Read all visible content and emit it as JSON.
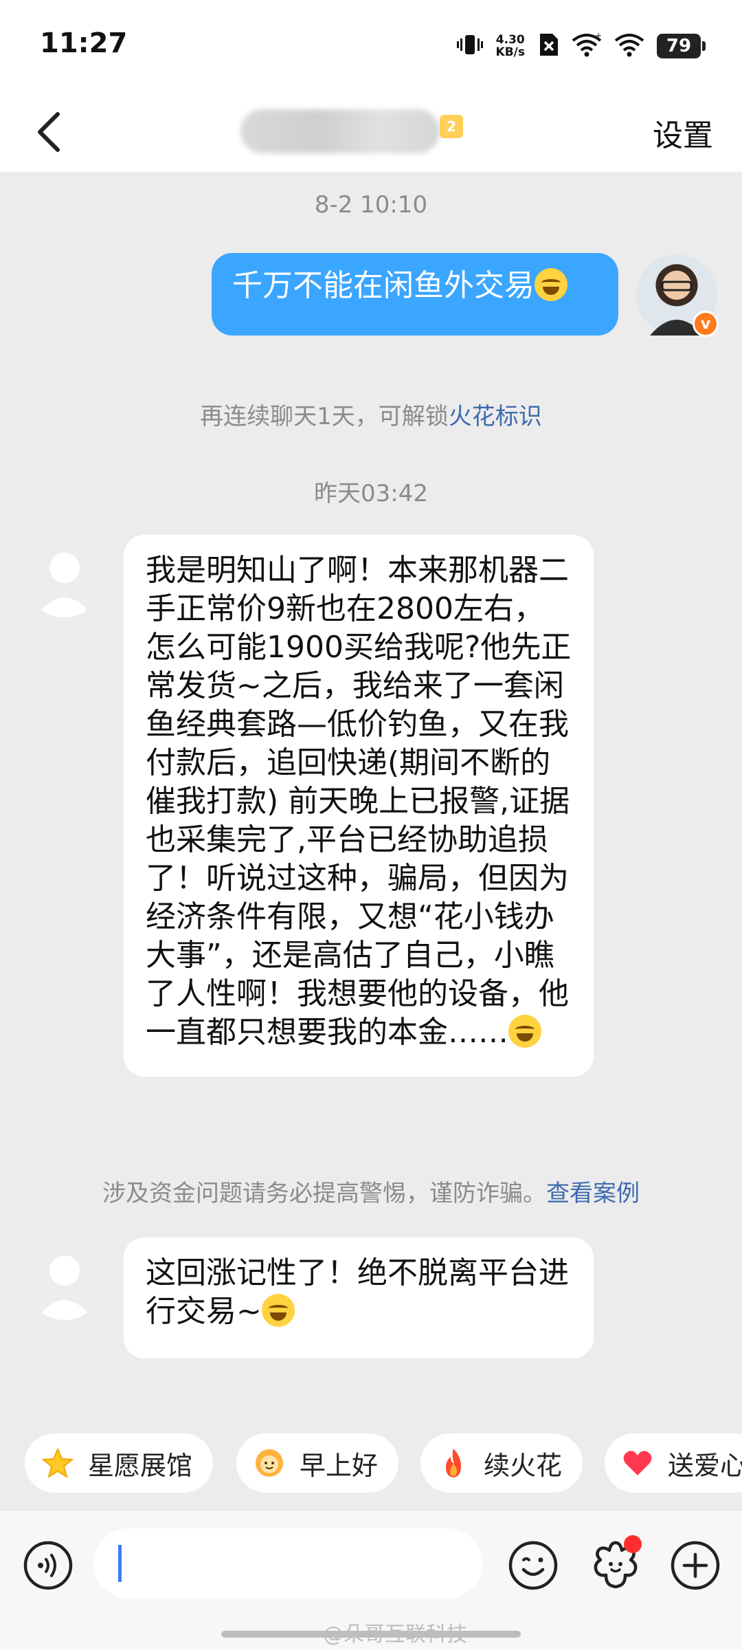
{
  "status_bar": {
    "time": "11:27",
    "net_speed_value": "4.30",
    "net_speed_unit": "KB/s",
    "battery": "79"
  },
  "header": {
    "title": "■■■■■■■■■■",
    "badge": "2",
    "settings_label": "设置"
  },
  "messages": [
    {
      "type": "time",
      "text": "8-2 10:10"
    },
    {
      "type": "sent",
      "text": "千万不能在闲鱼外交易"
    },
    {
      "type": "system",
      "text": "再连续聊天1天，可解锁",
      "link": "火花标识"
    },
    {
      "type": "time",
      "text": "昨天03:42"
    },
    {
      "type": "received",
      "text": "我是明知山了啊！本来那机器二手正常价9新也在2800左右，怎么可能1900买给我呢?他先正常发货~之后，我给来了一套闲鱼经典套路—低价钓鱼，又在我付款后，追回快递(期间不断的催我打款) 前天晚上已报警,证据也采集完了,平台已经协助追损了！听说过这种，骗局，但因为经济条件有限，又想“花小钱办大事”，还是高估了自己，小瞧了人性啊！我想要他的设备，他一直都只想要我的本金……"
    },
    {
      "type": "system",
      "text": "涉及资金问题请务必提高警惕，谨防诈骗。",
      "link": "查看案例"
    },
    {
      "type": "received",
      "text": "这回涨记性了！绝不脱离平台进行交易~"
    }
  ],
  "quick_replies": [
    {
      "label": "星愿展馆",
      "icon": "star-icon"
    },
    {
      "label": "早上好",
      "icon": "sun-face-icon"
    },
    {
      "label": "续火花",
      "icon": "fire-icon"
    },
    {
      "label": "送爱心",
      "icon": "heart-icon"
    }
  ],
  "input": {
    "value": "",
    "placeholder": ""
  },
  "watermark": "@朵哥互联科技",
  "colors": {
    "sent_bubble": "#3aa6ff",
    "link": "#3f6bb0",
    "background": "#ececec",
    "notification_dot": "#ff2d2d"
  }
}
